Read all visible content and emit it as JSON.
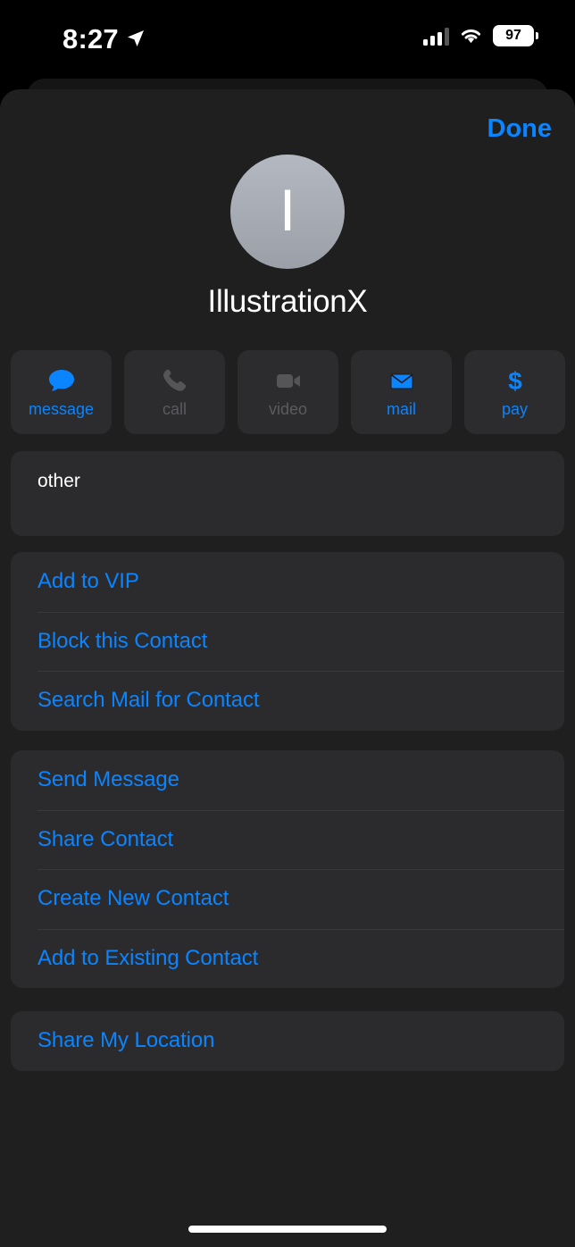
{
  "status_bar": {
    "time": "8:27",
    "location_icon": "location-arrow-icon",
    "signal_icon": "cellular-signal-icon",
    "wifi_icon": "wifi-icon",
    "battery_percent": "97"
  },
  "header": {
    "done_label": "Done"
  },
  "contact": {
    "avatar_initial": "I",
    "avatar_color": "#a8acb5",
    "name": "IllustrationX"
  },
  "actions": [
    {
      "label": "message",
      "icon": "message-bubble-icon",
      "enabled": true
    },
    {
      "label": "call",
      "icon": "phone-icon",
      "enabled": false
    },
    {
      "label": "video",
      "icon": "video-camera-icon",
      "enabled": false
    },
    {
      "label": "mail",
      "icon": "envelope-icon",
      "enabled": true
    },
    {
      "label": "pay",
      "icon": "dollar-sign-icon",
      "enabled": true
    }
  ],
  "other_field": {
    "label": "other",
    "value": " "
  },
  "mail_actions": [
    {
      "label": "Add to VIP"
    },
    {
      "label": "Block this Contact"
    },
    {
      "label": "Search Mail for Contact"
    }
  ],
  "share_actions": [
    {
      "label": "Send Message"
    },
    {
      "label": "Share Contact"
    },
    {
      "label": "Create New Contact"
    },
    {
      "label": "Add to Existing Contact"
    }
  ],
  "location_actions": [
    {
      "label": "Share My Location"
    }
  ],
  "colors": {
    "accent_blue": "#0a84ff",
    "sheet_bg": "#1f1f1f",
    "card_bg": "#2b2b2d",
    "disabled_gray": "#5b5b5f"
  }
}
